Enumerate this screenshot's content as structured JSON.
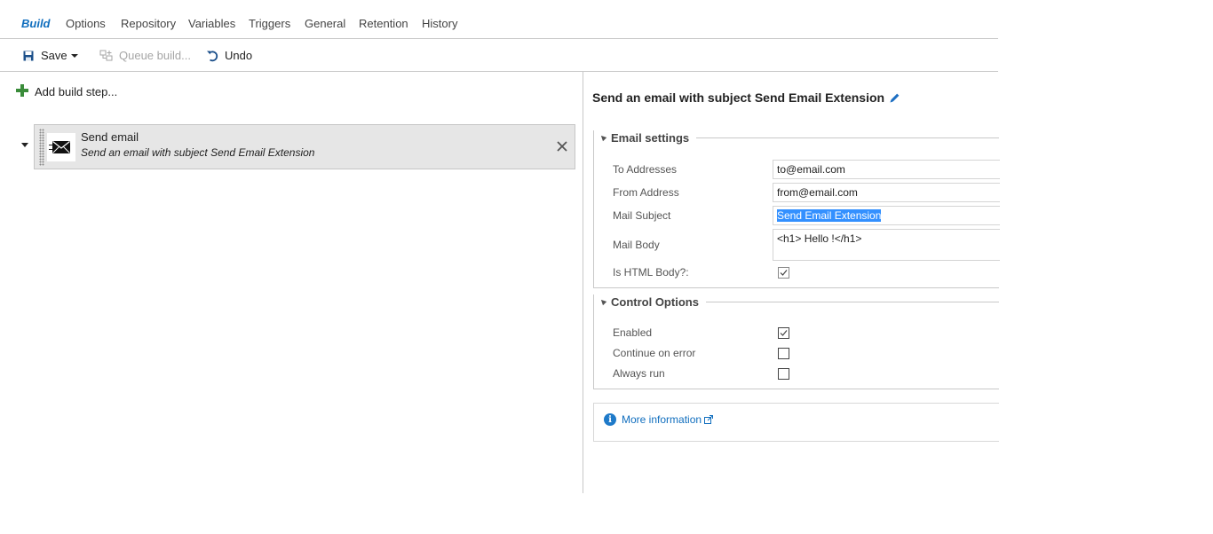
{
  "tabs": [
    {
      "label": "Build",
      "active": true
    },
    {
      "label": "Options"
    },
    {
      "label": "Repository"
    },
    {
      "label": "Variables"
    },
    {
      "label": "Triggers"
    },
    {
      "label": "General"
    },
    {
      "label": "Retention"
    },
    {
      "label": "History"
    }
  ],
  "toolbar": {
    "save_label": "Save",
    "queue_label": "Queue build...",
    "undo_label": "Undo"
  },
  "left": {
    "add_step_label": "Add build step...",
    "step": {
      "title": "Send email",
      "subtitle": "Send an email with subject Send Email Extension",
      "icon": "envelope-icon"
    }
  },
  "detail": {
    "title": "Send an email with subject Send Email Extension",
    "email_section": {
      "title": "Email settings",
      "to_label": "To Addresses",
      "to_value": "to@email.com",
      "from_label": "From Address",
      "from_value": "from@email.com",
      "subject_label": "Mail Subject",
      "subject_value": "Send Email Extension",
      "body_label": "Mail Body",
      "body_value": "<h1> Hello !</h1>",
      "html_label": "Is HTML Body?:",
      "html_checked": true
    },
    "control_section": {
      "title": "Control Options",
      "enabled_label": "Enabled",
      "enabled_checked": true,
      "continue_label": "Continue on error",
      "continue_checked": false,
      "always_label": "Always run",
      "always_checked": false
    },
    "more_info_label": "More information"
  },
  "colors": {
    "accent": "#106ebe",
    "selection": "#3390ff",
    "step_bg": "#e6e6e6",
    "add_icon": "#3a8c3a"
  }
}
